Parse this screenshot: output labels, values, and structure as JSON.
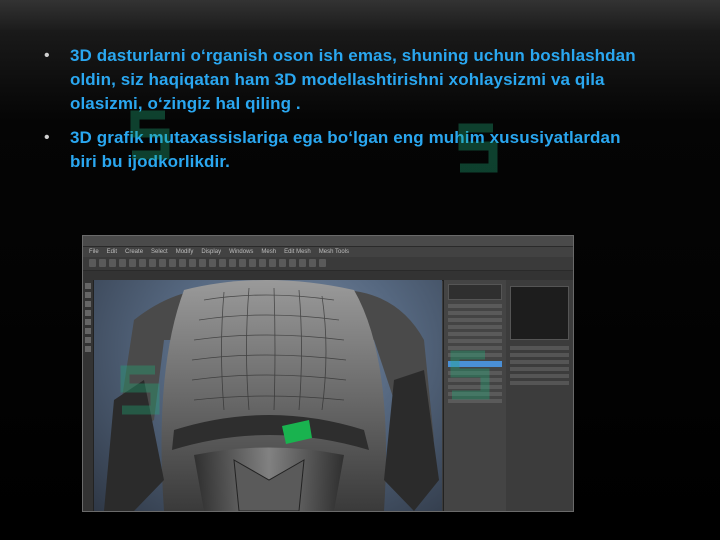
{
  "bullets": [
    {
      "text": "3D dasturlarni o‘rganish oson ish emas, shuning uchun boshlashdan oldin, siz haqiqatan ham 3D modellashtirishni xohlaysizmi va qila olasizmi, o‘zingiz hal qiling ."
    },
    {
      "text": "3D grafik mutaxassislariga ega bo‘lgan eng muhim xususiyatlardan biri bu ijodkorlikdir."
    }
  ],
  "bullet_symbol": "•",
  "colors": {
    "text": "#2aa7f0",
    "background": "#000000",
    "watermark": "#1fae7a"
  },
  "screenshot": {
    "menu": [
      "File",
      "Edit",
      "Create",
      "Select",
      "Modify",
      "Display",
      "Windows",
      "Mesh",
      "Edit Mesh",
      "Mesh Tools"
    ],
    "subject": "3D character torso model in Maya-like 3D modeling software"
  }
}
